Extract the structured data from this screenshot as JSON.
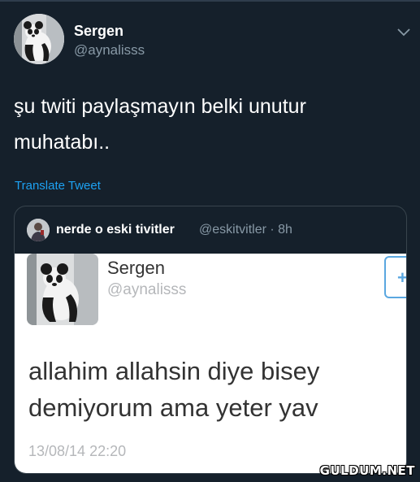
{
  "tweet": {
    "user_name": "Sergen",
    "user_handle": "@aynalisss",
    "text": "şu twiti paylaşmayın belki unutur\nmuhatabı..",
    "translate_label": "Translate Tweet"
  },
  "quote": {
    "user_name": "nerde o eski tivitler",
    "handle_and_time": "@eskitvitler · 8h",
    "image": {
      "user_name": "Sergen",
      "user_handle": "@aynalisss",
      "text": "allahim allahsin diye bisey\ndemiyorum ama yeter yav",
      "date": "13/08/14 22:20",
      "follow_icon": "+"
    }
  },
  "watermark": "GULDUM.NET",
  "colors": {
    "background": "#15202b",
    "accent": "#1da1f2",
    "secondary_text": "#8899a6",
    "border": "#38444d"
  }
}
